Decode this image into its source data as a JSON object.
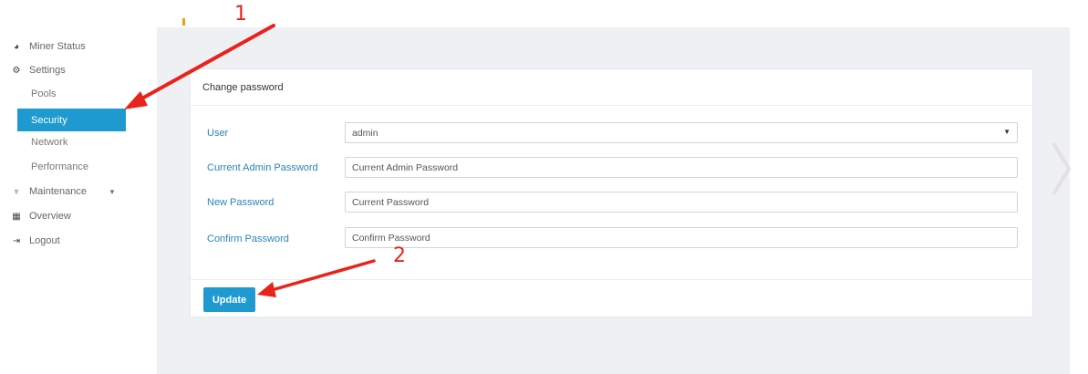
{
  "sidebar": {
    "items": [
      {
        "label": "Miner Status",
        "icon": "dashboard-icon"
      },
      {
        "label": "Settings",
        "icon": "cogs-icon"
      },
      {
        "label": "Maintenance",
        "icon": "plug-icon"
      },
      {
        "label": "Overview",
        "icon": "list-icon"
      },
      {
        "label": "Logout",
        "icon": "sign-out-icon"
      }
    ],
    "settings_sub": [
      {
        "label": "Pools"
      },
      {
        "label": "Security",
        "active": true
      },
      {
        "label": "Network"
      },
      {
        "label": "Performance"
      }
    ]
  },
  "panel": {
    "title": "Change password",
    "fields": [
      {
        "label": "User",
        "value": "admin",
        "type": "select"
      },
      {
        "label": "Current Admin Password",
        "placeholder": "Current Admin Password"
      },
      {
        "label": "New Password",
        "placeholder": "Current Password"
      },
      {
        "label": "Confirm Password",
        "placeholder": "Confirm Password"
      }
    ],
    "update_label": "Update"
  },
  "annotations": {
    "step1": "1",
    "step2": "2",
    "arrow_color": "#e8231b"
  },
  "colors": {
    "accent": "#1f9ad0",
    "label_blue": "#2a84c0",
    "main_bg": "#eef0f4"
  }
}
